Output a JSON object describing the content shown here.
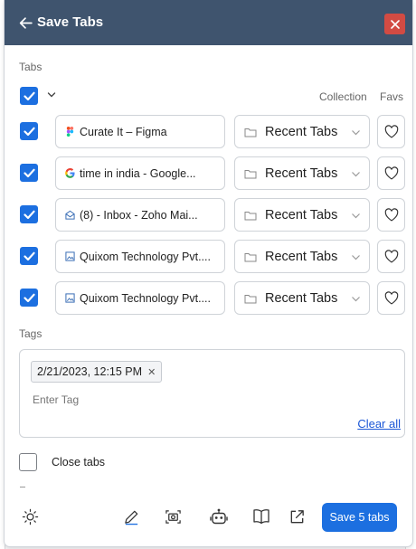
{
  "header": {
    "title": "Save Tabs"
  },
  "tabs_section": {
    "label": "Tabs",
    "col_collection": "Collection",
    "col_favs": "Favs",
    "rows": [
      {
        "title": "Curate It – Figma",
        "favicon": "figma-icon",
        "collection": "Recent Tabs",
        "checked": true
      },
      {
        "title": "time in india - Google...",
        "favicon": "google-icon",
        "collection": "Recent Tabs",
        "checked": true
      },
      {
        "title": "(8) - Inbox - Zoho Mai...",
        "favicon": "mail-icon",
        "collection": "Recent Tabs",
        "checked": true
      },
      {
        "title": "Quixom Technology Pvt....",
        "favicon": "image-icon",
        "collection": "Recent Tabs",
        "checked": true
      },
      {
        "title": "Quixom Technology Pvt....",
        "favicon": "image-icon",
        "collection": "Recent Tabs",
        "checked": true
      }
    ]
  },
  "tags_section": {
    "label": "Tags",
    "chips": [
      "2/21/2023, 12:15 PM"
    ],
    "input_placeholder": "Enter Tag",
    "clear_all": "Clear all"
  },
  "options": {
    "close_tabs_label": "Close tabs",
    "close_tabs_checked": false
  },
  "footer": {
    "save_label": "Save 5 tabs"
  },
  "colors": {
    "header_bg": "#3f546e",
    "accent": "#1c6fe0",
    "close_btn": "#d24b43",
    "link": "#1a56d6"
  }
}
